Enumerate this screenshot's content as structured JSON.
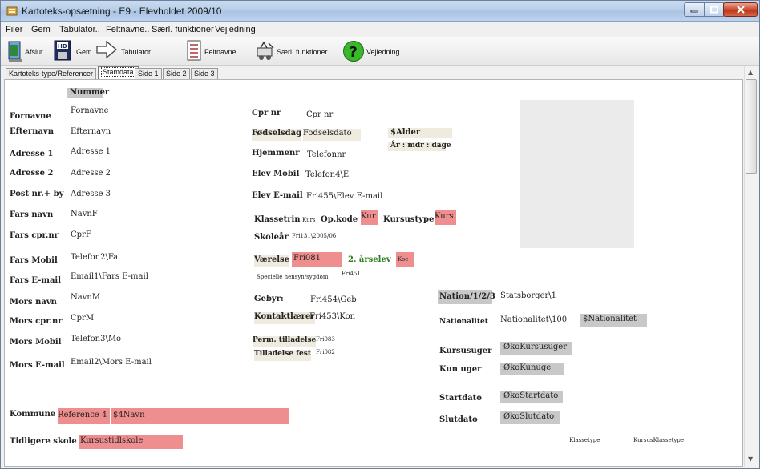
{
  "window": {
    "title": "Kartoteks-opsætning - E9 - Elevholdet 2009/10"
  },
  "menu": [
    "Filer",
    "Gem",
    "Tabulator..",
    "Feltnavne..",
    "Særl. funktioner",
    "Vejledning"
  ],
  "toolbar": {
    "afslut": "Afslut",
    "gem": "Gem",
    "tabulator": "Tabulator...",
    "feltnavne": "Feltnavne...",
    "saerl": "Særl. funktioner",
    "vejledning": "Vejledning"
  },
  "tabs": [
    "Kartoteks-type/Referencer",
    "Stamdata",
    "Side 1",
    "Side 2",
    "Side 3"
  ],
  "form": {
    "nummer": "Nummer",
    "fornavne_l": "Fornavne",
    "fornavne_v": "Fornavne",
    "efternavn_l": "Efternavn",
    "efternavn_v": "Efternavn",
    "adresse1_l": "Adresse 1",
    "adresse1_v": "Adresse 1",
    "adresse2_l": "Adresse 2",
    "adresse2_v": "Adresse 2",
    "postnr_l": "Post nr.+ by",
    "postnr_v": "Adresse 3",
    "farsnavn_l": "Fars navn",
    "farsnavn_v": "NavnF",
    "farscpr_l": "Fars cpr.nr",
    "farscpr_v": "CprF",
    "farsmobil_l": "Fars Mobil",
    "farsmobil_v": "Telefon2\\Fa",
    "farsemail_l": "Fars E-mail",
    "farsemail_v": "Email1\\Fars E-mail",
    "morsnavn_l": "Mors navn",
    "morsnavn_v": "NavnM",
    "morscpr_l": "Mors cpr.nr",
    "morscpr_v": "CprM",
    "morsmobil_l": "Mors Mobil",
    "morsmobil_v": "Telefon3\\Mo",
    "morsemail_l": "Mors E-mail",
    "morsemail_v": "Email2\\Mors E-mail",
    "kommune_l": "Kommune",
    "kommune_ref": "Reference 4",
    "kommune_navn": "$4Navn",
    "tidligere_l": "Tidligere skole",
    "tidligere_v": "Kursustidlskole",
    "cpr_l": "Cpr nr",
    "cpr_v": "Cpr nr",
    "fods_l": "Fødselsdag",
    "fods_v": "Fodselsdato",
    "alder": "$Alder",
    "aar": "År : mdr : dage",
    "hjem_l": "Hjemmenr",
    "hjem_v": "Telefonnr",
    "elevmobil_l": "Elev Mobil",
    "elevmobil_v": "Telefon4\\E",
    "elevemail_l": "Elev E-mail",
    "elevemail_v": "Fri455\\Elev E-mail",
    "klassetrin_l": "Klassetrin",
    "klassetrin_v": "Kurs",
    "opkode_l": "Op.kode",
    "opkode_v": "Kur",
    "kursustype_l": "Kursustype",
    "kursustype_v": "Kurs",
    "skoleaar_l": "Skoleår",
    "skoleaar_v": "Fri131\\2005/06",
    "vaerelse_l": "Værelse",
    "vaerelse_v": "Fri081",
    "aarselev": "2. årselev",
    "aarselev_v": "Koc",
    "specielle_l": "Specielle hensyn/sygdom",
    "specielle_v": "Fri451",
    "gebyr_l": "Gebyr:",
    "gebyr_v": "Fri454\\Geb",
    "kontakt_l": "Kontaktlærer",
    "kontakt_v": "Fri453\\Kon",
    "perm_l": "Perm. tilladelse",
    "perm_v": "Fri083",
    "tillfest_l": "Tilladelse fest",
    "tillfest_v": "Fri082",
    "nation_l": "Nation/1/2/3",
    "nation_v": "Statsborger\\1",
    "nationalitet_l": "Nationalitet",
    "nationalitet_v": "Nationalitet\\100",
    "nationalitet_s": "$Nationalitet",
    "kursusuger_l": "Kursusuger",
    "kursusuger_v": "ØkoKursusuger",
    "kunuger_l": "Kun uger",
    "kunuger_v": "ØkoKunuge",
    "startdato_l": "Startdato",
    "startdato_v": "ØkoStartdato",
    "slutdato_l": "Slutdato",
    "slutdato_v": "ØkoSlutdato",
    "klassetype": "Klassetype",
    "kursusklassetype": "KursusKlassetype"
  }
}
